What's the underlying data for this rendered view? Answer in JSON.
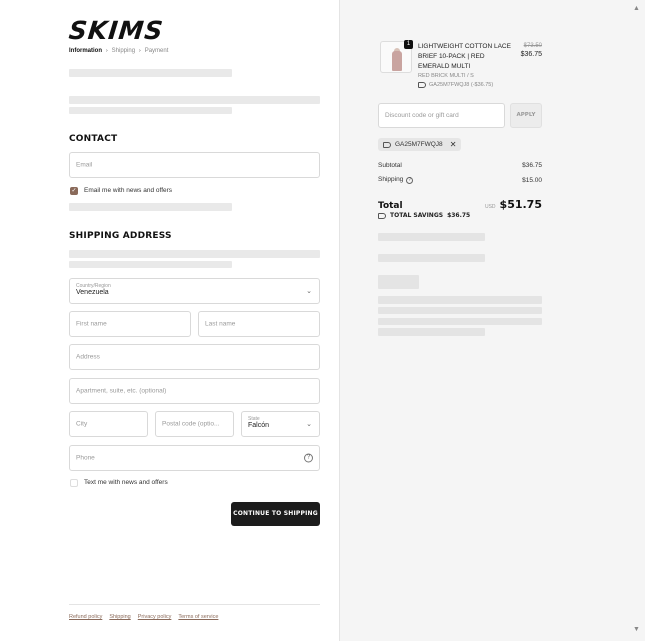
{
  "brand": {
    "logo": "SKIMS"
  },
  "breadcrumb": {
    "current": "Information",
    "step2": "Shipping",
    "step3": "Payment",
    "sep": "›"
  },
  "contact": {
    "heading": "CONTACT",
    "email_placeholder": "Email",
    "newsletter_label": "Email me with news and offers",
    "newsletter_checked": true
  },
  "shipping": {
    "heading": "SHIPPING ADDRESS",
    "country_label": "Country/Region",
    "country_value": "Venezuela",
    "first_name_placeholder": "First name",
    "last_name_placeholder": "Last name",
    "address_placeholder": "Address",
    "apartment_placeholder": "Apartment, suite, etc. (optional)",
    "city_placeholder": "City",
    "postal_placeholder": "Postal code (optio...",
    "state_label": "State",
    "state_value": "Falcón",
    "phone_placeholder": "Phone",
    "sms_label": "Text me with news and offers",
    "sms_checked": false
  },
  "actions": {
    "continue_label": "CONTINUE TO SHIPPING"
  },
  "footer": {
    "links": [
      "Refund policy",
      "Shipping",
      "Privacy policy",
      "Terms of service"
    ]
  },
  "cart": {
    "item": {
      "quantity": "1",
      "name": "LIGHTWEIGHT COTTON LACE BRIEF 10-PACK | RED EMERALD MULTI",
      "variant": "RED BRICK MULTI / S",
      "discount_line": "GA25M7FWQJ8 (-$36.75)",
      "compare_price": "$73.50",
      "price": "$36.75"
    },
    "discount_placeholder": "Discount code or gift card",
    "apply_label": "APPLY",
    "applied_code": "GA25M7FWQJ8",
    "subtotal_label": "Subtotal",
    "subtotal_value": "$36.75",
    "shipping_label": "Shipping",
    "shipping_value": "$15.00",
    "total_label": "Total",
    "currency": "USD",
    "total_value": "$51.75",
    "savings_label": "TOTAL SAVINGS",
    "savings_value": "$36.75"
  },
  "colors": {
    "accent": "#8a6a5a",
    "button": "#1c1c1c",
    "sidebar_bg": "#f5f5f5"
  }
}
